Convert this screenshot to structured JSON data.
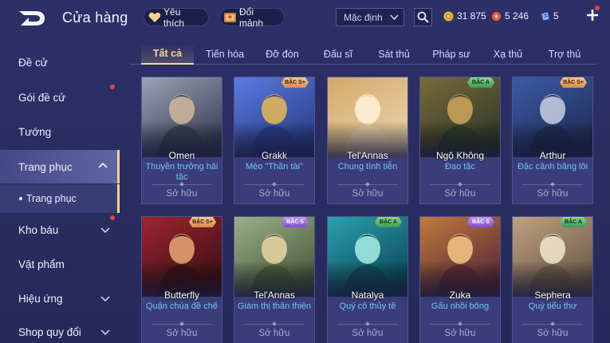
{
  "header": {
    "title": "Cửa hàng",
    "favorites_label": "Yêu thích",
    "fragments_label": "Đổi mảnh",
    "sort_selected": "Mặc định",
    "currencies": [
      {
        "name": "gold",
        "value": "31 875",
        "color": "#e9c95a"
      },
      {
        "name": "ruby",
        "value": "5 246",
        "color": "#e05a4c"
      },
      {
        "name": "voucher",
        "value": "5",
        "color": "#8fb5ff"
      }
    ]
  },
  "sidebar": {
    "items": [
      {
        "label": "Đề cử"
      },
      {
        "label": "Gói đề cử"
      },
      {
        "label": "Tướng"
      },
      {
        "label": "Trang phục"
      },
      {
        "label": "Kho báu"
      },
      {
        "label": "Vật phẩm"
      },
      {
        "label": "Hiệu ứng"
      },
      {
        "label": "Shop quy đổi"
      }
    ],
    "sub_item": "Trang phục"
  },
  "tabs": [
    "Tất cả",
    "Tiến hóa",
    "Đỡ đòn",
    "Đấu sĩ",
    "Sát thủ",
    "Pháp sư",
    "Xạ thủ",
    "Trợ thủ"
  ],
  "cards": [
    {
      "name": "Omen",
      "skin": "Thuyền trưởng hải tặc",
      "status": "Sở hữu",
      "badge": "",
      "badge_kind": "",
      "palette": [
        "#3a3f55",
        "#9aa3b8",
        "#c9b49a"
      ]
    },
    {
      "name": "Grakk",
      "skin": "Mèo \"Thần tài\"",
      "status": "Sở hữu",
      "badge": "BẬC S+",
      "badge_kind": "s",
      "palette": [
        "#2b3f8a",
        "#5a7be0",
        "#e0b45a"
      ]
    },
    {
      "name": "Tel'Annas",
      "skin": "Chung tình tiễn",
      "status": "Sở hữu",
      "badge": "",
      "badge_kind": "",
      "palette": [
        "#e8d1a8",
        "#d4a868",
        "#fff1d6"
      ]
    },
    {
      "name": "Ngộ Không",
      "skin": "Đạo tặc",
      "status": "Sở hữu",
      "badge": "BẬC A",
      "badge_kind": "a",
      "palette": [
        "#2f3b2a",
        "#7a6a3a",
        "#c9a15a"
      ]
    },
    {
      "name": "Arthur",
      "skin": "Đặc cảnh băng lôi",
      "status": "Sở hữu",
      "badge": "BẬC S+",
      "badge_kind": "s",
      "palette": [
        "#1f2f55",
        "#3c5aa8",
        "#c0c8e0"
      ]
    },
    {
      "name": "Butterfly",
      "skin": "Quận chúa đề chế",
      "status": "Sở hữu",
      "badge": "BẬC S+",
      "badge_kind": "s",
      "palette": [
        "#3a1014",
        "#a02430",
        "#e0a070"
      ]
    },
    {
      "name": "Tel'Annas",
      "skin": "Giám thị thân thiện",
      "status": "Sở hữu",
      "badge": "BẬC S",
      "badge_kind": "s5",
      "palette": [
        "#4a5a3a",
        "#9ab08a",
        "#e0d0a0"
      ]
    },
    {
      "name": "Natalya",
      "skin": "Quý cô thủy tề",
      "status": "Sở hữu",
      "badge": "BẬC A",
      "badge_kind": "a",
      "palette": [
        "#0f4a5a",
        "#2aa0b0",
        "#a0e8e0"
      ]
    },
    {
      "name": "Zuka",
      "skin": "Gấu nhồi bông",
      "status": "Sở hữu",
      "badge": "BẬC S",
      "badge_kind": "s5",
      "palette": [
        "#5a2a3a",
        "#c07a3a",
        "#f0c080"
      ]
    },
    {
      "name": "Sephera",
      "skin": "Quý tiểu thư",
      "status": "Sở hữu",
      "badge": "BẬC A",
      "badge_kind": "a",
      "palette": [
        "#6a5a4a",
        "#c0a080",
        "#f0e0c8"
      ]
    }
  ]
}
